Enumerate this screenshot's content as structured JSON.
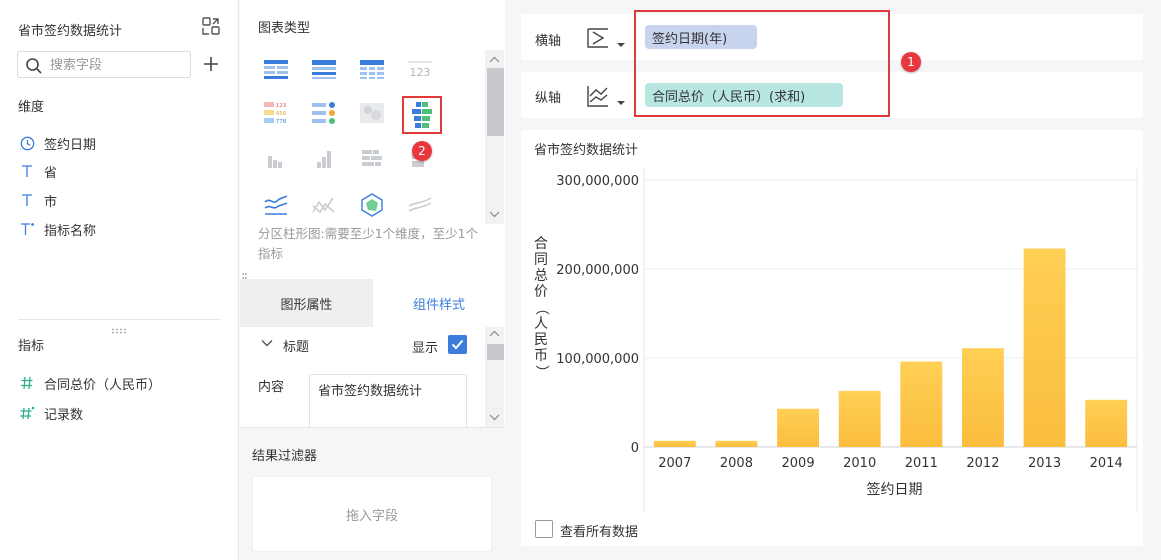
{
  "left_panel": {
    "dataset_title": "省市签约数据统计",
    "search_placeholder": "搜索字段",
    "dimensions_label": "维度",
    "dimensions": [
      "签约日期",
      "省",
      "市",
      "指标名称"
    ],
    "metrics_label": "指标",
    "metrics": [
      "合同总价（人民币）",
      "记录数"
    ]
  },
  "middle_panel": {
    "chart_types_title": "图表类型",
    "chart_type_description": "分区柱形图:需要至少1个维度，至少1个指标",
    "table_icon_label": "123",
    "mini_table_labels": [
      "123",
      "456",
      "778"
    ],
    "tabs": [
      "图形属性",
      "组件样式"
    ],
    "title_section_label": "标题",
    "show_label": "显示",
    "content_label": "内容",
    "content_value": "省市签约数据统计",
    "result_filter_title": "结果过滤器",
    "drop_field_hint": "拖入字段"
  },
  "axis_config": {
    "x_label": "横轴",
    "x_field": "签约日期(年)",
    "y_label": "纵轴",
    "y_field": "合同总价（人民币）(求和)",
    "annotation_badges": [
      "1",
      "2"
    ]
  },
  "chart": {
    "title": "省市签约数据统计",
    "see_all_label": "查看所有数据"
  },
  "chart_data": {
    "type": "bar",
    "title": "省市签约数据统计",
    "xlabel": "签约日期",
    "ylabel": "合同总价（人民币）",
    "categories": [
      "2007",
      "2008",
      "2009",
      "2010",
      "2011",
      "2012",
      "2013",
      "2014"
    ],
    "values": [
      7000000,
      7000000,
      43000000,
      63000000,
      96000000,
      111000000,
      223000000,
      53000000
    ],
    "ylim": [
      0,
      300000000
    ],
    "yticks": [
      "0",
      "100,000,000",
      "200,000,000",
      "300,000,000"
    ],
    "bar_color": "#ffc84a",
    "grid": true
  },
  "colors": {
    "accent": "#3b7ddd",
    "annotation_red": "#e03a3a",
    "x_pill": "#c8d3ee",
    "y_pill": "#b8e6e0"
  }
}
